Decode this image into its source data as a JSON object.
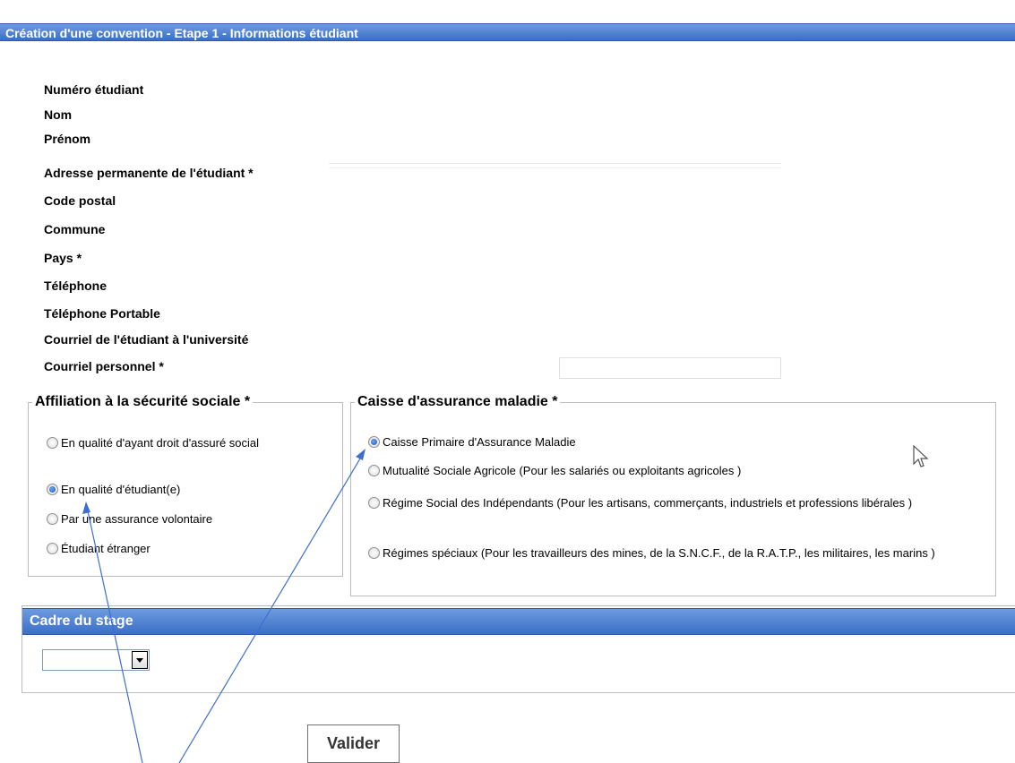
{
  "header": {
    "title": "Création d'une convention - Etape 1 - Informations étudiant"
  },
  "student_fields": [
    "Numéro étudiant",
    "Nom",
    "Prénom",
    "Adresse permanente de l'étudiant *",
    "Code postal",
    "Commune",
    "Pays *",
    "Téléphone",
    "Téléphone Portable",
    "Courriel de l'étudiant à l'université",
    "Courriel personnel *"
  ],
  "affiliation": {
    "legend": "Affiliation à la sécurité sociale *",
    "options": [
      "En qualité d'ayant droit d'assuré social",
      "En qualité d'étudiant(e)",
      "Par une assurance volontaire",
      "Étudiant étranger"
    ],
    "selected": "En qualité d'étudiant(e)"
  },
  "caisse": {
    "legend": "Caisse d'assurance maladie *",
    "options": [
      "Caisse Primaire d'Assurance Maladie",
      "Mutualité Sociale Agricole (Pour les salariés ou exploitants agricoles )",
      "Régime Social des Indépendants (Pour les artisans, commerçants, industriels et professions libérales )",
      "Régimes spéciaux (Pour les travailleurs des mines, de la S.N.C.F., de la R.A.T.P., les militaires, les marins )"
    ],
    "selected": "Caisse Primaire d'Assurance Maladie"
  },
  "cadre": {
    "title": "Cadre du stage",
    "select_value": ""
  },
  "actions": {
    "submit_label": "Valider"
  },
  "colors": {
    "header_blue": "#4a7fd4",
    "annotation_arrow": "#3c6fd0",
    "radio_selected": "#1c4fb0"
  },
  "icons": [
    "radio-icon",
    "dropdown-arrow-icon",
    "mouse-cursor-icon",
    "annotation-arrow-icon"
  ]
}
